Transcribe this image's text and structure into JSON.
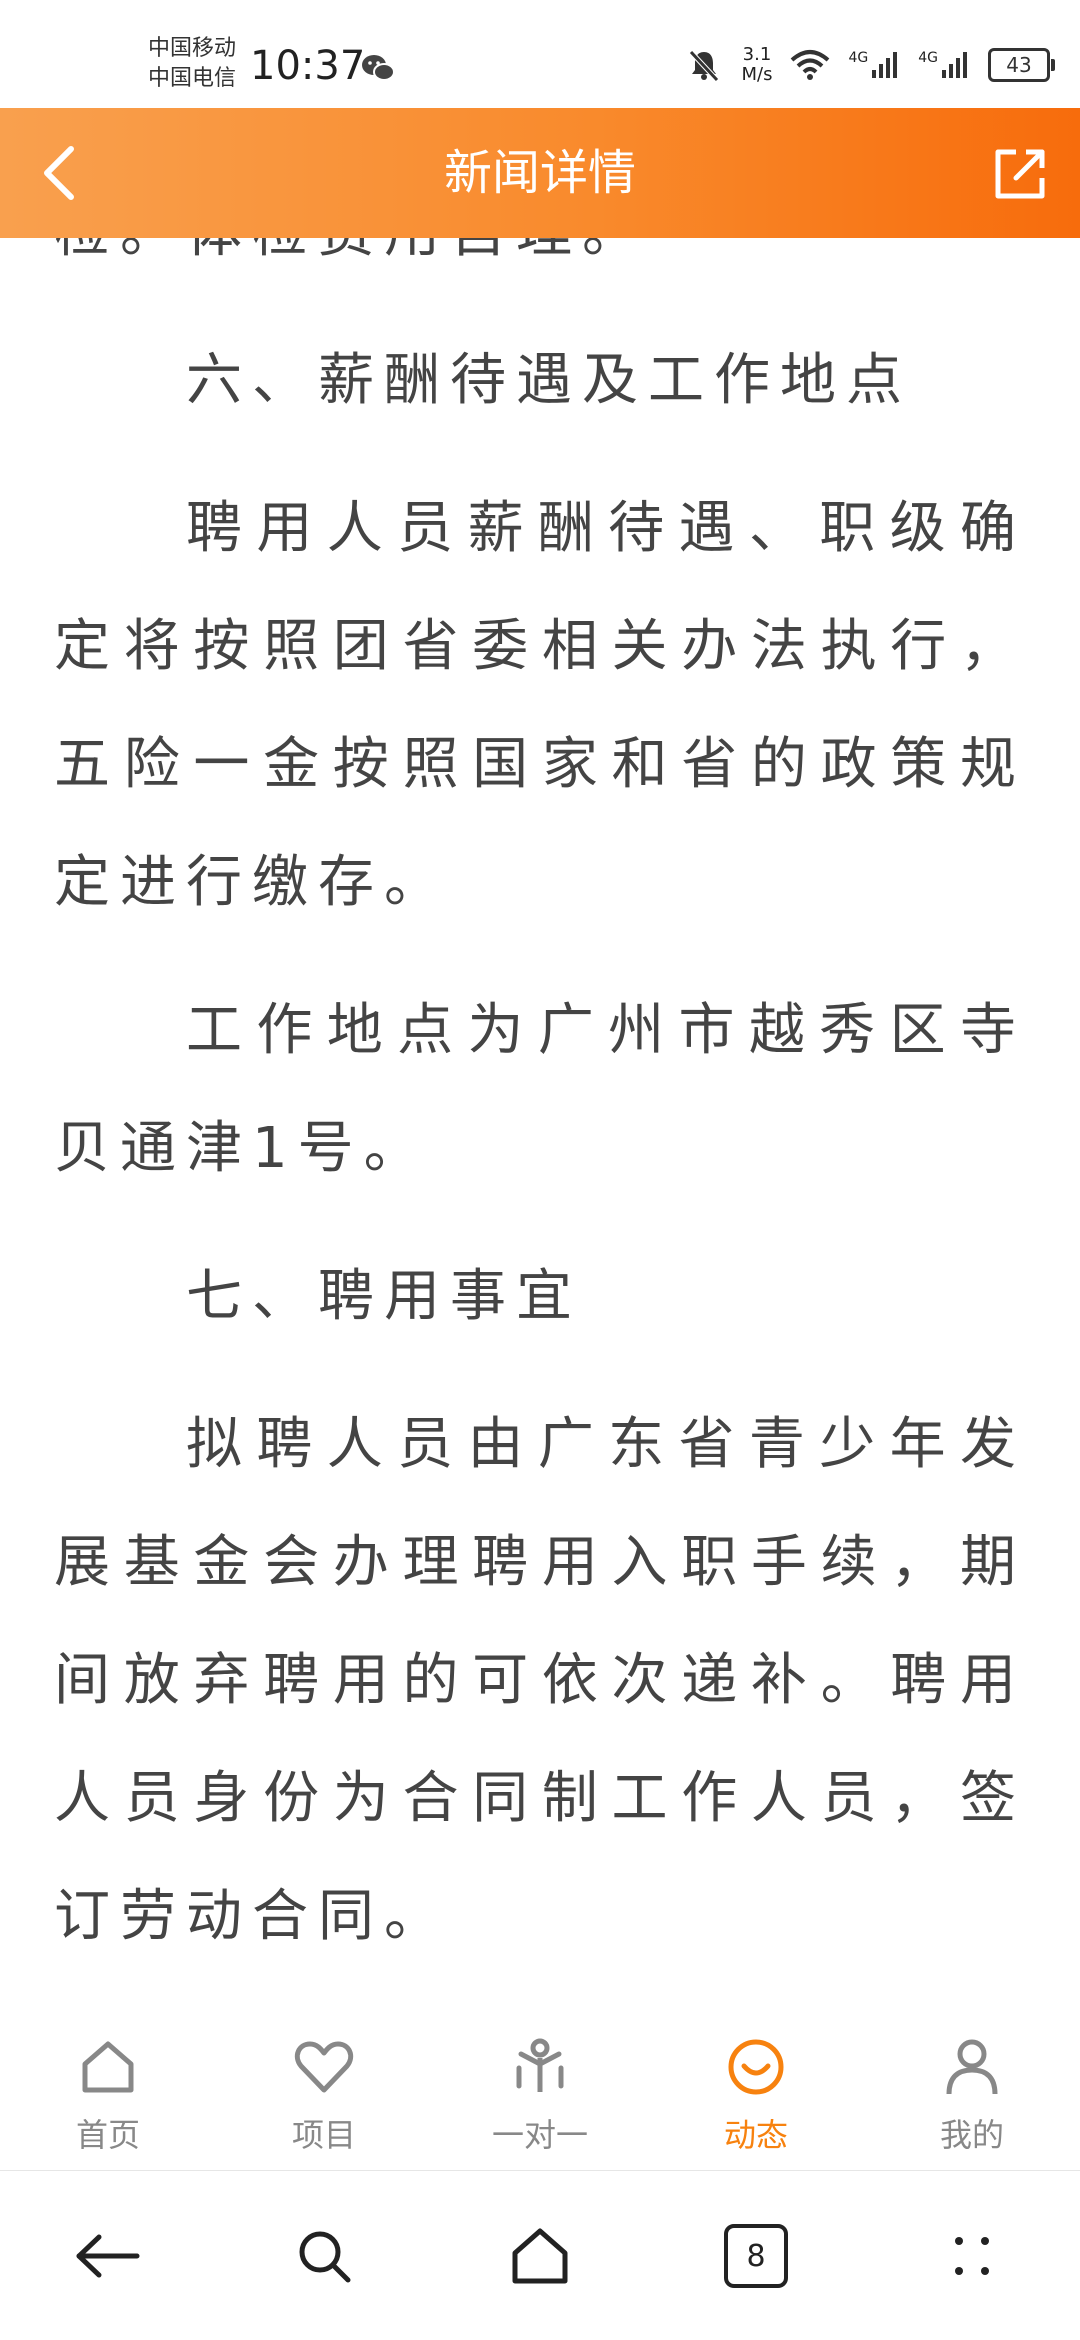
{
  "status_bar": {
    "carrier_1": "中国移动",
    "carrier_2": "中国电信",
    "time": "10:37",
    "speed_value": "3.1",
    "speed_unit": "M/s",
    "network_1": "4G",
    "network_2": "4G",
    "battery": "43"
  },
  "header": {
    "title": "新闻详情",
    "back_icon": "chevron-left-icon",
    "share_icon": "share-external-icon"
  },
  "article": {
    "paragraphs": [
      "检。体检费用自理。",
      "六、薪酬待遇及工作地点",
      "聘用人员薪酬待遇、职级确定将按照团省委相关办法执行，五险一金按照国家和省的政策规定进行缴存。",
      "工作地点为广州市越秀区寺贝通津1号。",
      "七、聘用事宜",
      "拟聘人员由广东省青少年发展基金会办理聘用入职手续，期间放弃聘用的可依次递补。聘用人员身份为合同制工作人员，签订劳动合同。"
    ]
  },
  "tabbar": {
    "items": [
      {
        "label": "首页",
        "icon": "home-icon"
      },
      {
        "label": "项目",
        "icon": "heart-icon"
      },
      {
        "label": "一对一",
        "icon": "people-icon"
      },
      {
        "label": "动态",
        "icon": "smile-icon"
      },
      {
        "label": "我的",
        "icon": "user-icon"
      }
    ],
    "active_index": 3
  },
  "navbar": {
    "tabs_count": "8"
  },
  "colors": {
    "accent": "#f7820f",
    "header_start": "#f9a04e",
    "header_end": "#f76c0c"
  }
}
